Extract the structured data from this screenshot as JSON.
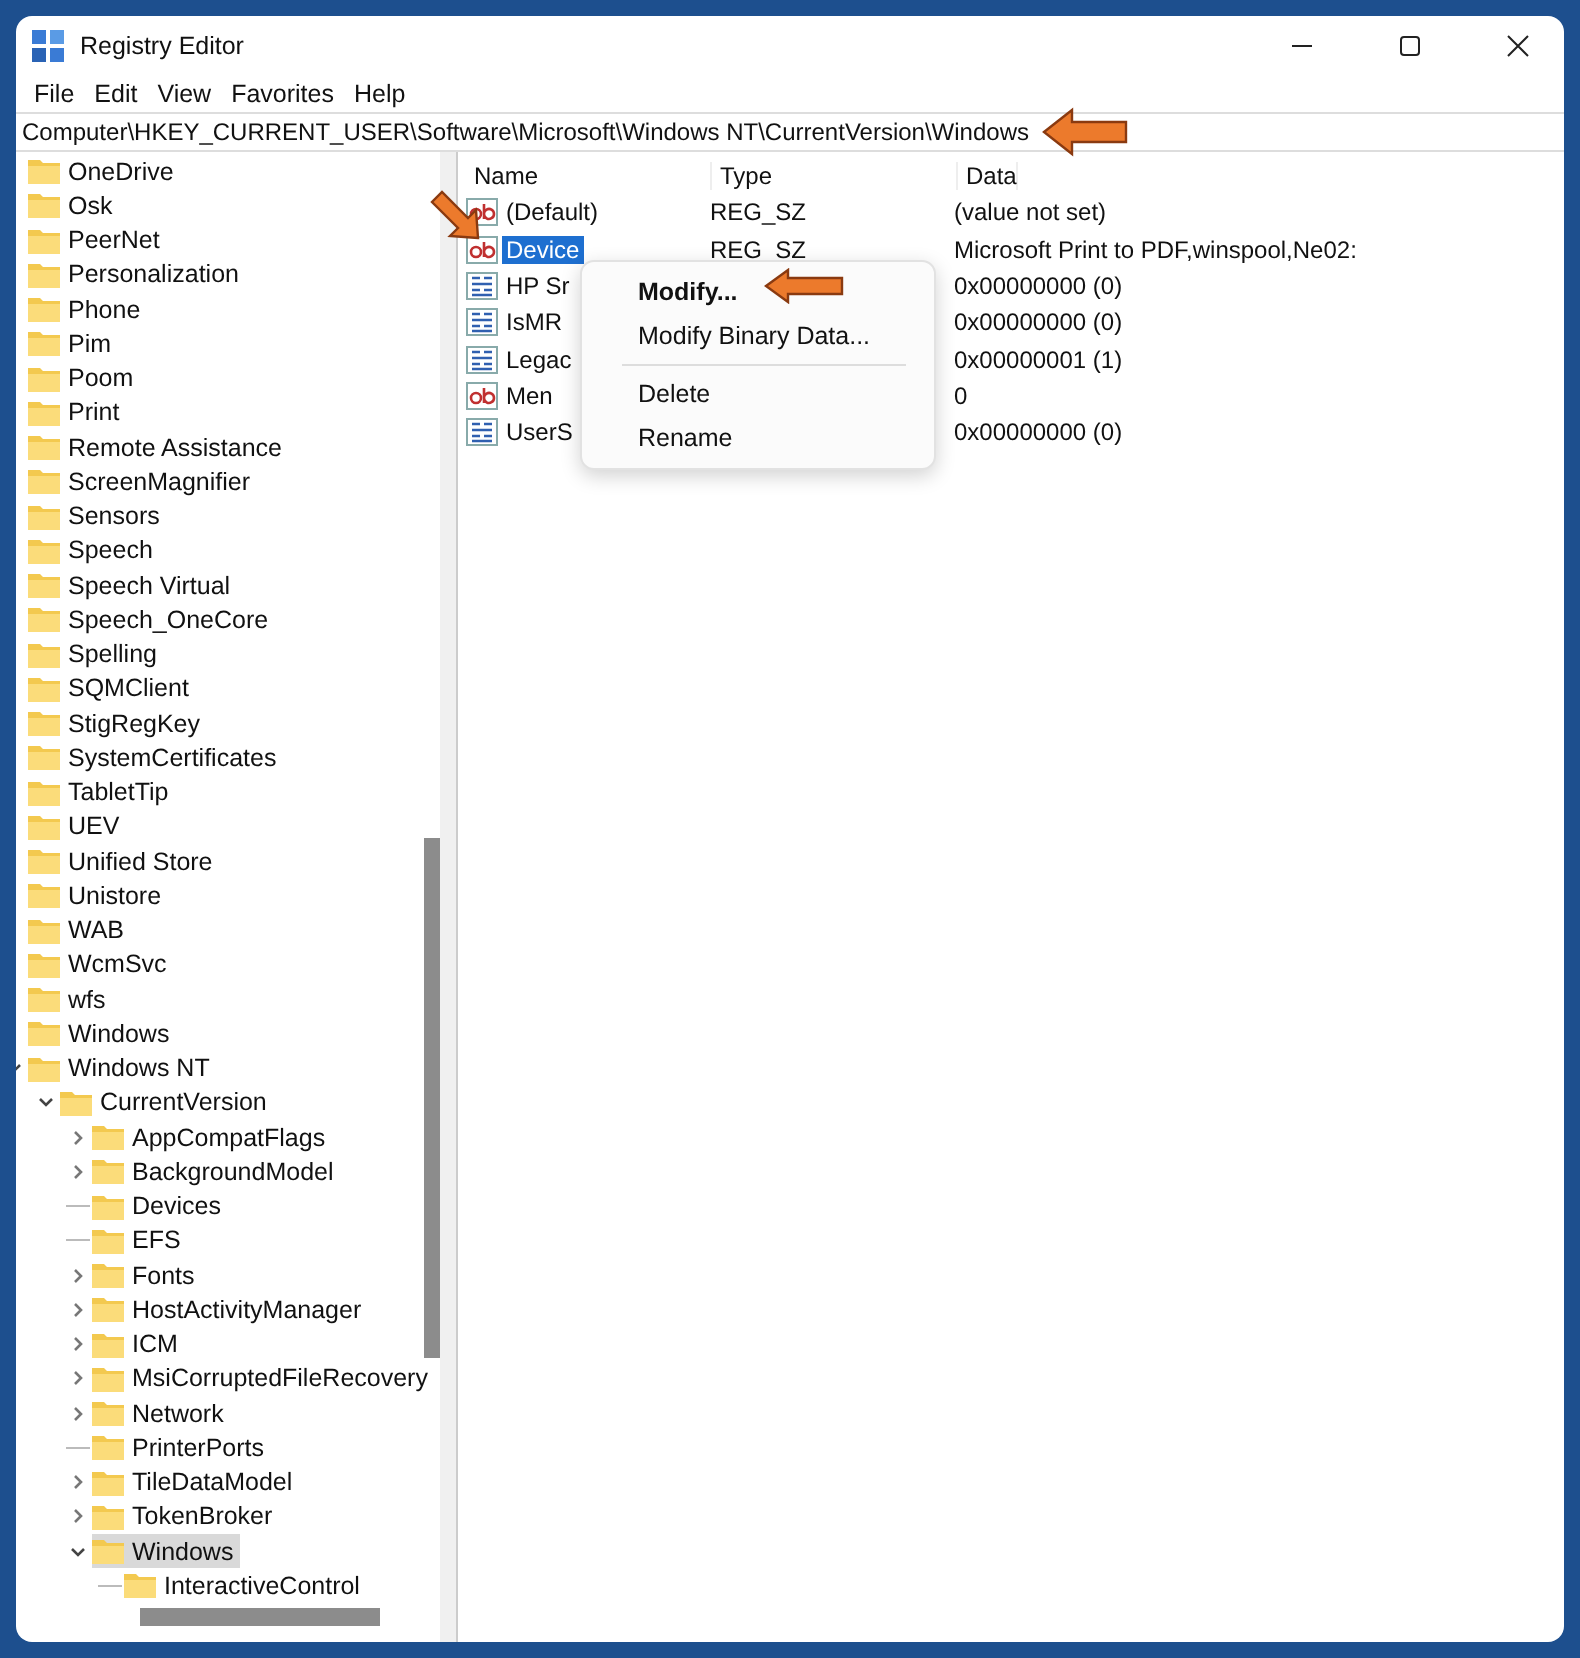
{
  "window": {
    "title": "Registry Editor"
  },
  "menu": [
    "File",
    "Edit",
    "View",
    "Favorites",
    "Help"
  ],
  "address": "Computer\\HKEY_CURRENT_USER\\Software\\Microsoft\\Windows NT\\CurrentVersion\\Windows",
  "tree": [
    {
      "label": "OneDrive",
      "selected": false
    },
    {
      "label": "Osk",
      "selected": false
    },
    {
      "label": "PeerNet",
      "selected": false
    },
    {
      "label": "Personalization",
      "selected": false
    },
    {
      "label": "Phone",
      "selected": false
    },
    {
      "label": "Pim",
      "selected": false
    },
    {
      "label": "Poom",
      "selected": false
    },
    {
      "label": "Print",
      "selected": false
    },
    {
      "label": "Remote Assistance",
      "selected": false
    },
    {
      "label": "ScreenMagnifier",
      "selected": false
    },
    {
      "label": "Sensors",
      "selected": false
    },
    {
      "label": "Speech",
      "selected": false
    },
    {
      "label": "Speech Virtual",
      "selected": false
    },
    {
      "label": "Speech_OneCore",
      "selected": false
    },
    {
      "label": "Spelling",
      "selected": false
    },
    {
      "label": "SQMClient",
      "selected": false
    },
    {
      "label": "StigRegKey",
      "selected": false
    },
    {
      "label": "SystemCertificates",
      "selected": false
    },
    {
      "label": "TabletTip",
      "selected": false
    },
    {
      "label": "UEV",
      "selected": false
    },
    {
      "label": "Unified Store",
      "selected": false
    },
    {
      "label": "Unistore",
      "selected": false
    },
    {
      "label": "WAB",
      "selected": false
    },
    {
      "label": "WcmSvc",
      "selected": false
    },
    {
      "label": "wfs",
      "selected": false
    },
    {
      "label": "Windows",
      "selected": false
    },
    {
      "label": "Windows NT",
      "selected": false,
      "expanded": true,
      "children": [
        {
          "label": "CurrentVersion",
          "selected": false,
          "expandable": true,
          "expanded": true,
          "children": [
            {
              "label": "AppCompatFlags",
              "selected": false,
              "expandable": true,
              "expanded": false
            },
            {
              "label": "BackgroundModel",
              "selected": false,
              "expandable": true,
              "expanded": false
            },
            {
              "label": "Devices",
              "selected": false,
              "expandable": false
            },
            {
              "label": "EFS",
              "selected": false,
              "expandable": false
            },
            {
              "label": "Fonts",
              "selected": false,
              "expandable": true,
              "expanded": false
            },
            {
              "label": "HostActivityManager",
              "selected": false,
              "expandable": true,
              "expanded": false
            },
            {
              "label": "ICM",
              "selected": false,
              "expandable": true,
              "expanded": false
            },
            {
              "label": "MsiCorruptedFileRecovery",
              "selected": false,
              "expandable": true,
              "expanded": false
            },
            {
              "label": "Network",
              "selected": false,
              "expandable": true,
              "expanded": false
            },
            {
              "label": "PrinterPorts",
              "selected": false,
              "expandable": false
            },
            {
              "label": "TileDataModel",
              "selected": false,
              "expandable": true,
              "expanded": false
            },
            {
              "label": "TokenBroker",
              "selected": false,
              "expandable": true,
              "expanded": false
            },
            {
              "label": "Windows",
              "selected": true,
              "expandable": true,
              "expanded": true,
              "children": [
                {
                  "label": "InteractiveControl",
                  "selected": false,
                  "expandable": false
                }
              ]
            }
          ]
        }
      ]
    }
  ],
  "columns": [
    "Name",
    "Type",
    "Data"
  ],
  "values": [
    {
      "kind": "string",
      "name": "(Default)",
      "type": "REG_SZ",
      "data": "(value not set)",
      "selected": false
    },
    {
      "kind": "string",
      "name": "Device",
      "type": "REG_SZ",
      "data": "Microsoft Print to PDF,winspool,Ne02:",
      "selected": true
    },
    {
      "kind": "dword",
      "name": "HP Sr",
      "data": "0x00000000 (0)",
      "selected": false
    },
    {
      "kind": "dword",
      "name": "IsMR",
      "data": "0x00000000 (0)",
      "selected": false
    },
    {
      "kind": "dword",
      "name": "Legac",
      "data": "0x00000001 (1)",
      "selected": false
    },
    {
      "kind": "string",
      "name": "Men",
      "data": "0",
      "selected": false
    },
    {
      "kind": "dword",
      "name": "UserS",
      "data": "0x00000000 (0)",
      "selected": false
    }
  ],
  "context_menu": [
    {
      "kind": "item",
      "label": "Modify...",
      "default": true
    },
    {
      "kind": "item",
      "label": "Modify Binary Data...",
      "default": false
    },
    {
      "kind": "separator"
    },
    {
      "kind": "item",
      "label": "Delete",
      "default": false
    },
    {
      "kind": "item",
      "label": "Rename",
      "default": false
    }
  ]
}
